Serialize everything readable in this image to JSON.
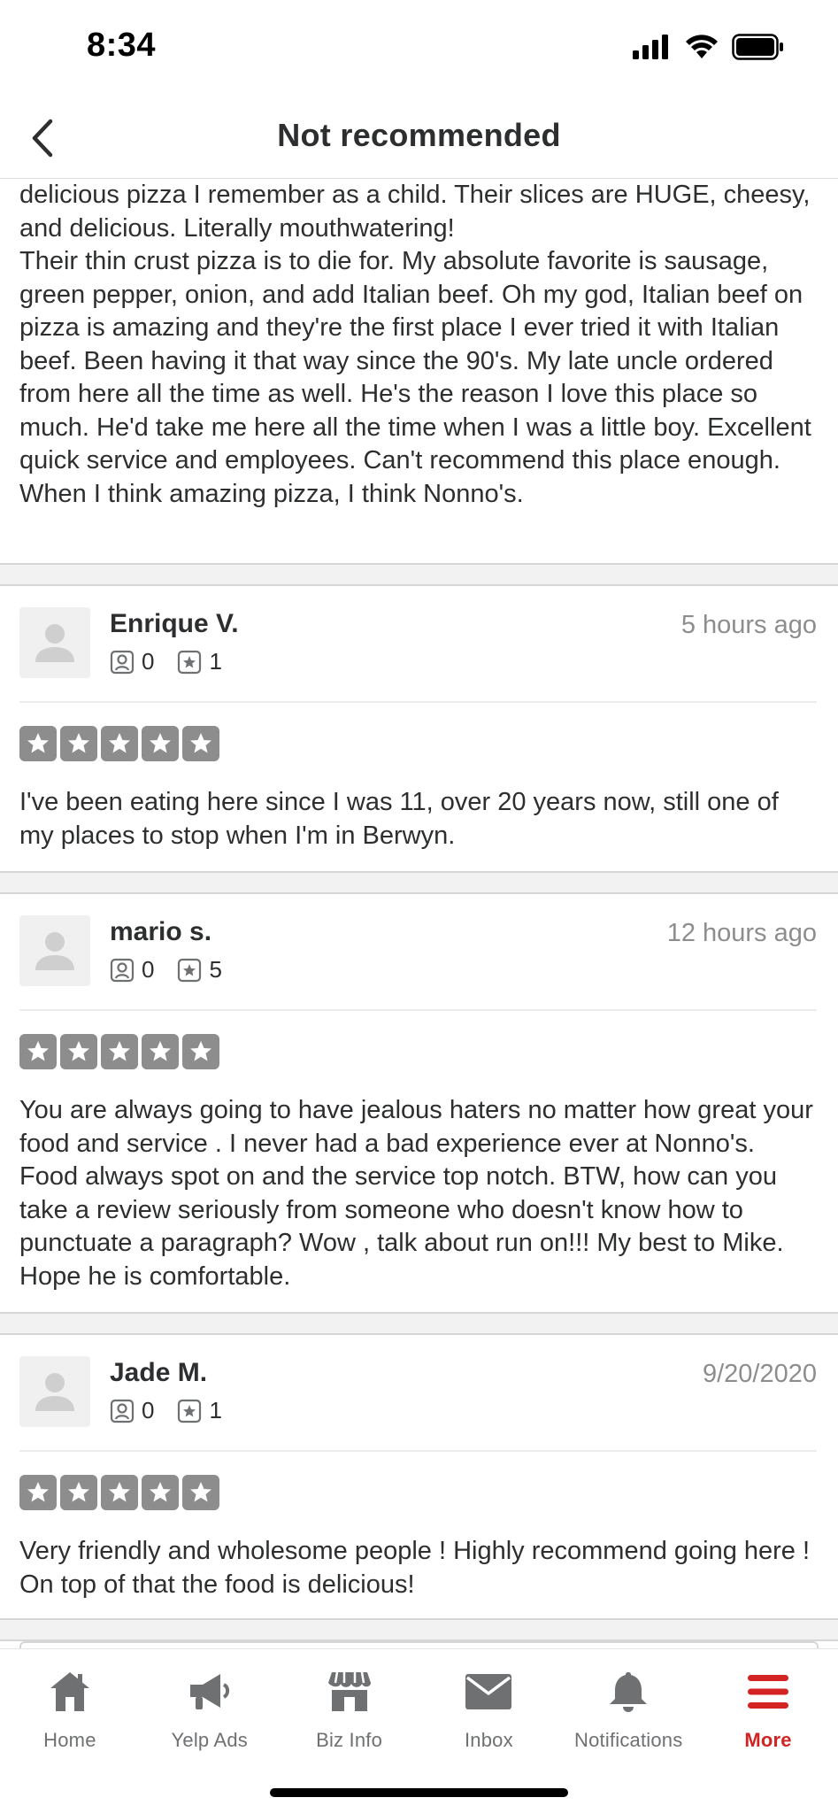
{
  "status_bar": {
    "time": "8:34"
  },
  "nav": {
    "title": "Not recommended"
  },
  "top_review": {
    "text": "delicious pizza I remember as a child. Their slices are HUGE, cheesy, and delicious. Literally mouthwatering!\nTheir thin crust pizza is to die for. My absolute favorite is sausage, green pepper, onion, and add Italian beef. Oh my god, Italian beef on pizza is amazing and they're the first place I ever tried it with Italian beef. Been having it that way since the 90's. My late uncle ordered from here all the time as well. He's the reason I love this place so much. He'd take me here all the time when I was a little boy. Excellent quick service and employees. Can't recommend this place enough. When I think amazing pizza, I think Nonno's."
  },
  "reviews": [
    {
      "name": "Enrique V.",
      "date": "5 hours ago",
      "friends": "0",
      "reviews_count": "1",
      "rating": 5,
      "text": "I've been eating here since I was 11, over 20 years now, still one of my places to stop when I'm in Berwyn."
    },
    {
      "name": "mario s.",
      "date": "12 hours ago",
      "friends": "0",
      "reviews_count": "5",
      "rating": 5,
      "text": "You are always going to have jealous haters no matter how great your food and service . I never had a bad experience ever at Nonno's. Food always spot on and the service top notch.  BTW, how can you take a review seriously from someone who doesn't  know how to punctuate a paragraph? Wow , talk about run on!!! My best to Mike. Hope he is comfortable."
    },
    {
      "name": "Jade M.",
      "date": "9/20/2020",
      "friends": "0",
      "reviews_count": "1",
      "rating": 5,
      "text": "Very friendly and wholesome people ! Highly recommend going here ! On top of that the food is delicious!"
    }
  ],
  "tab_bar": {
    "tabs": [
      {
        "label": "Home",
        "icon": "home-icon"
      },
      {
        "label": "Yelp Ads",
        "icon": "megaphone-icon"
      },
      {
        "label": "Biz Info",
        "icon": "storefront-icon"
      },
      {
        "label": "Inbox",
        "icon": "envelope-icon"
      },
      {
        "label": "Notifications",
        "icon": "bell-icon"
      },
      {
        "label": "More",
        "icon": "hamburger-menu-icon"
      }
    ],
    "active": "More"
  },
  "colors": {
    "accent": "#d32323",
    "star_gray": "#8d8d8d",
    "text": "#2d2e2f"
  }
}
